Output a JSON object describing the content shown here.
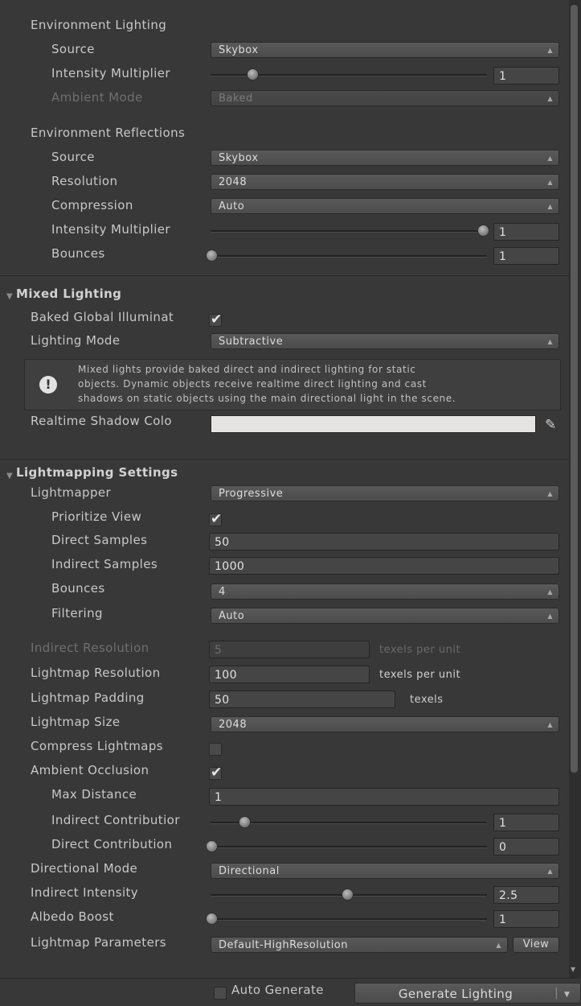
{
  "env_lighting": {
    "header": "Environment Lighting",
    "source_label": "Source",
    "source_value": "Skybox",
    "intensity_label": "Intensity Multiplier",
    "intensity_value": "1",
    "intensity_slider": 0.15,
    "ambient_label": "Ambient Mode",
    "ambient_value": "Baked"
  },
  "env_reflections": {
    "header": "Environment Reflections",
    "source_label": "Source",
    "source_value": "Skybox",
    "resolution_label": "Resolution",
    "resolution_value": "2048",
    "compression_label": "Compression",
    "compression_value": "Auto",
    "intensity_label": "Intensity Multiplier",
    "intensity_value": "1",
    "intensity_slider": 1.0,
    "bounces_label": "Bounces",
    "bounces_value": "1",
    "bounces_slider": 0.0
  },
  "mixed_lighting": {
    "header": "Mixed Lighting",
    "baked_gi_label": "Baked Global Illuminat",
    "baked_gi_checked": true,
    "lighting_mode_label": "Lighting Mode",
    "lighting_mode_value": "Subtractive",
    "info_line1": "Mixed lights provide baked direct and indirect lighting for static",
    "info_line2": "objects. Dynamic objects receive realtime direct lighting and cast",
    "info_line3": "shadows on static objects using the main directional light in the scene.",
    "shadow_color_label": "Realtime Shadow Colo",
    "shadow_color_hex": "#e6e3e3"
  },
  "lightmapping": {
    "header": "Lightmapping Settings",
    "lightmapper_label": "Lightmapper",
    "lightmapper_value": "Progressive",
    "prioritize_label": "Prioritize View",
    "prioritize_checked": true,
    "direct_samples_label": "Direct Samples",
    "direct_samples_value": "50",
    "indirect_samples_label": "Indirect Samples",
    "indirect_samples_value": "1000",
    "bounces_label": "Bounces",
    "bounces_value": "4",
    "filtering_label": "Filtering",
    "filtering_value": "Auto",
    "indirect_res_label": "Indirect Resolution",
    "indirect_res_value": "5",
    "indirect_res_unit": "texels per unit",
    "lightmap_res_label": "Lightmap Resolution",
    "lightmap_res_value": "100",
    "lightmap_res_unit": "texels per unit",
    "padding_label": "Lightmap Padding",
    "padding_value": "50",
    "padding_unit": "texels",
    "size_label": "Lightmap Size",
    "size_value": "2048",
    "compress_label": "Compress Lightmaps",
    "compress_checked": false,
    "ao_label": "Ambient Occlusion",
    "ao_checked": true,
    "max_distance_label": "Max Distance",
    "max_distance_value": "1",
    "indirect_contrib_label": "Indirect Contributior",
    "indirect_contrib_value": "1",
    "indirect_contrib_slider": 0.12,
    "direct_contrib_label": "Direct Contribution",
    "direct_contrib_value": "0",
    "direct_contrib_slider": 0.0,
    "directional_mode_label": "Directional Mode",
    "directional_mode_value": "Directional",
    "indirect_intensity_label": "Indirect Intensity",
    "indirect_intensity_value": "2.5",
    "indirect_intensity_slider": 0.5,
    "albedo_label": "Albedo Boost",
    "albedo_value": "1",
    "albedo_slider": 0.0,
    "params_label": "Lightmap Parameters",
    "params_value": "Default-HighResolution",
    "view_label": "View"
  },
  "footer": {
    "auto_generate_label": "Auto Generate",
    "auto_generate_checked": false,
    "generate_label": "Generate Lighting"
  },
  "icons": {
    "dropdown": "dropdown-arrow-icon",
    "info": "info-icon",
    "picker": "eyedropper-icon",
    "fold": "foldout-triangle-icon"
  }
}
